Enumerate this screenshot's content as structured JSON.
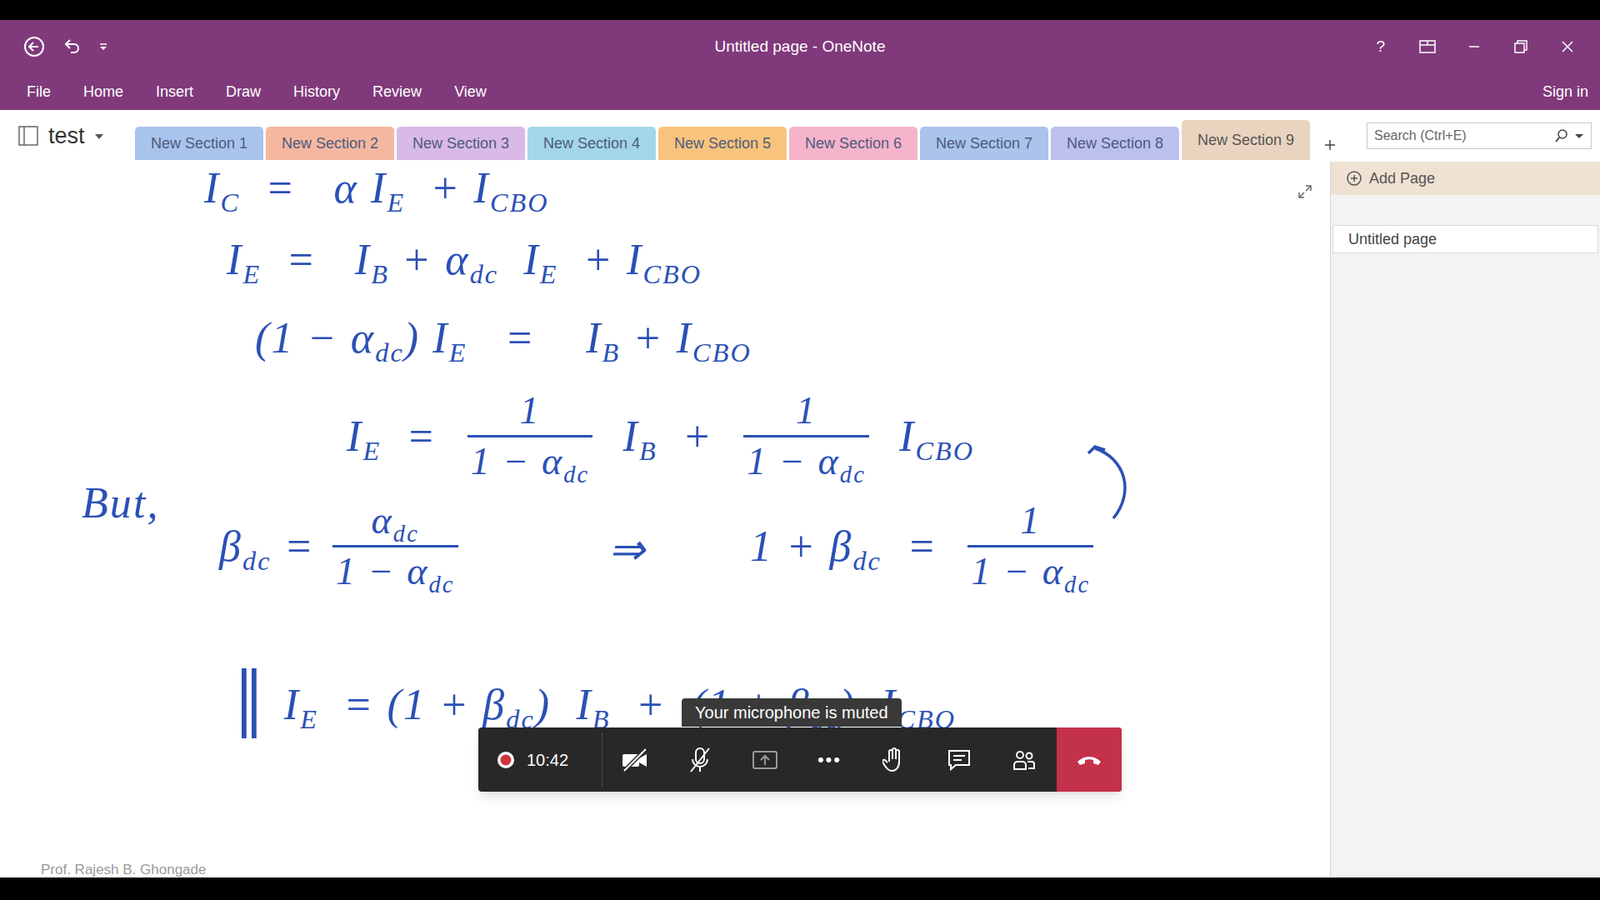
{
  "window": {
    "title": "Untitled page - OneNote",
    "help": "?",
    "sign_in": "Sign in"
  },
  "menu": [
    "File",
    "Home",
    "Insert",
    "Draw",
    "History",
    "Review",
    "View"
  ],
  "notebook": {
    "name": "test"
  },
  "sections": [
    {
      "label": "New Section 1",
      "color": "#a9c4ec",
      "selected": false
    },
    {
      "label": "New Section 2",
      "color": "#f6b7a1",
      "selected": false
    },
    {
      "label": "New Section 3",
      "color": "#d9b9e6",
      "selected": false
    },
    {
      "label": "New Section 4",
      "color": "#a3d6e8",
      "selected": false
    },
    {
      "label": "New Section 5",
      "color": "#f8c37c",
      "selected": false
    },
    {
      "label": "New Section 6",
      "color": "#f6b3cc",
      "selected": false
    },
    {
      "label": "New Section 7",
      "color": "#aac4ec",
      "selected": false
    },
    {
      "label": "New Section 8",
      "color": "#bcc0ec",
      "selected": false
    },
    {
      "label": "New Section 9",
      "color": "#e9d4bf",
      "selected": true
    }
  ],
  "search": {
    "placeholder": "Search (Ctrl+E)"
  },
  "pages": {
    "add_label": "Add Page",
    "items": [
      {
        "title": "Untitled page",
        "selected": true
      }
    ]
  },
  "ink": [
    {
      "items": [
        {
          "kind": "sym",
          "text": "I",
          "sub": "C"
        },
        {
          "kind": "sym",
          "text": "  =   α I",
          "sub": "E"
        },
        {
          "kind": "sym",
          "text": "  + I",
          "sub": "CBO"
        }
      ]
    },
    {
      "items": [
        {
          "kind": "sym",
          "text": "I",
          "sub": "E"
        },
        {
          "kind": "sym",
          "text": "  =   I",
          "sub": "B"
        },
        {
          "kind": "sym",
          "text": " + α",
          "sub": "dc"
        },
        {
          "kind": "sym",
          "text": "  I",
          "sub": "E"
        },
        {
          "kind": "sym",
          "text": "  + I",
          "sub": "CBO"
        }
      ]
    },
    {
      "items": [
        {
          "kind": "sym",
          "text": "(1 − α",
          "sub": "dc"
        },
        {
          "kind": "sym",
          "text": ") I",
          "sub": "E"
        },
        {
          "kind": "sym",
          "text": "   =    I",
          "sub": "B"
        },
        {
          "kind": "sym",
          "text": " + I",
          "sub": "CBO"
        }
      ]
    },
    {
      "items": [
        {
          "kind": "sym",
          "text": "I",
          "sub": "E"
        },
        {
          "kind": "sym",
          "text": "  =  "
        },
        {
          "kind": "frac",
          "num": [
            {
              "text": "1"
            }
          ],
          "den": [
            {
              "text": "1 − α",
              "sub": "dc"
            }
          ]
        },
        {
          "kind": "sym",
          "text": "  I",
          "sub": "B"
        },
        {
          "kind": "sym",
          "text": "  +  "
        },
        {
          "kind": "frac",
          "num": [
            {
              "text": "1"
            }
          ],
          "den": [
            {
              "text": "1 − α",
              "sub": "dc"
            }
          ]
        },
        {
          "kind": "sym",
          "text": "  I",
          "sub": "CBO"
        }
      ]
    },
    {
      "items": [
        {
          "kind": "sym",
          "text": "But,"
        }
      ]
    },
    {
      "items": [
        {
          "kind": "sym",
          "text": "β",
          "sub": "dc"
        },
        {
          "kind": "sym",
          "text": " = "
        },
        {
          "kind": "frac",
          "num": [
            {
              "text": "α",
              "sub": "dc"
            }
          ],
          "den": [
            {
              "text": "1 − α",
              "sub": "dc"
            }
          ]
        }
      ]
    },
    {
      "items": [
        {
          "kind": "sym",
          "text": "⇒"
        }
      ]
    },
    {
      "items": [
        {
          "kind": "sym",
          "text": "1 + β",
          "sub": "dc"
        },
        {
          "kind": "sym",
          "text": "  =  "
        },
        {
          "kind": "frac",
          "num": [
            {
              "text": "1"
            }
          ],
          "den": [
            {
              "text": "1 − α",
              "sub": "dc"
            }
          ]
        }
      ]
    },
    {
      "items": [
        {
          "kind": "big",
          "text": "‖"
        },
        {
          "kind": "sym",
          "text": " I",
          "sub": "E"
        },
        {
          "kind": "sym",
          "text": "  = (1 + β",
          "sub": "dc"
        },
        {
          "kind": "sym",
          "text": ")  I",
          "sub": "B"
        },
        {
          "kind": "sym",
          "text": "  +  (1 + β",
          "sub": "dc"
        },
        {
          "kind": "sym",
          "text": ")  "
        },
        {
          "kind": "sym",
          "text": "I",
          "sub": "CBO",
          "underlined": true
        }
      ]
    }
  ],
  "meeting": {
    "recording": true,
    "elapsed": "10:42",
    "camera_on": false,
    "mic_on": false,
    "more": "•••",
    "tooltip": "Your microphone is muted"
  },
  "watermark": "Prof. Rajesh B. Ghongade"
}
